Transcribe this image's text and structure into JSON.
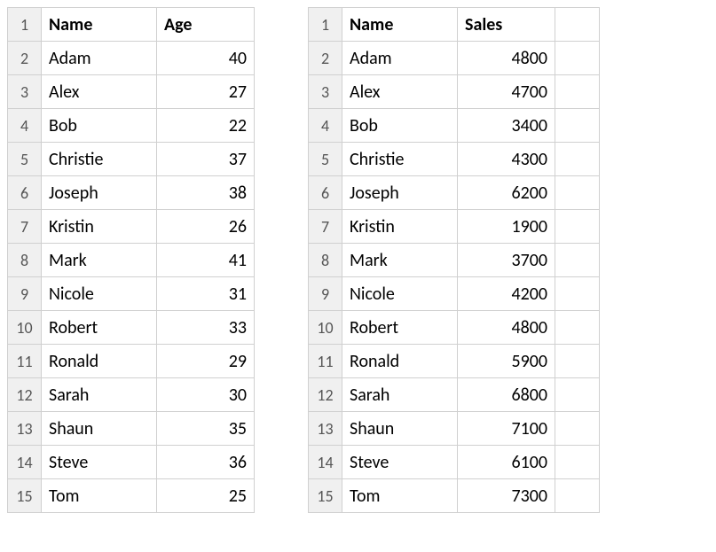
{
  "tables": [
    {
      "headers": {
        "col1": "Name",
        "col2": "Age"
      },
      "rows": [
        {
          "n": "1"
        },
        {
          "n": "2",
          "name": "Adam",
          "val": "40"
        },
        {
          "n": "3",
          "name": "Alex",
          "val": "27"
        },
        {
          "n": "4",
          "name": "Bob",
          "val": "22"
        },
        {
          "n": "5",
          "name": "Christie",
          "val": "37"
        },
        {
          "n": "6",
          "name": "Joseph",
          "val": "38"
        },
        {
          "n": "7",
          "name": "Kristin",
          "val": "26"
        },
        {
          "n": "8",
          "name": "Mark",
          "val": "41"
        },
        {
          "n": "9",
          "name": "Nicole",
          "val": "31"
        },
        {
          "n": "10",
          "name": "Robert",
          "val": "33"
        },
        {
          "n": "11",
          "name": "Ronald",
          "val": "29"
        },
        {
          "n": "12",
          "name": "Sarah",
          "val": "30"
        },
        {
          "n": "13",
          "name": "Shaun",
          "val": "35"
        },
        {
          "n": "14",
          "name": "Steve",
          "val": "36"
        },
        {
          "n": "15",
          "name": "Tom",
          "val": "25"
        }
      ]
    },
    {
      "headers": {
        "col1": "Name",
        "col2": "Sales"
      },
      "rows": [
        {
          "n": "1"
        },
        {
          "n": "2",
          "name": "Adam",
          "val": "4800"
        },
        {
          "n": "3",
          "name": "Alex",
          "val": "4700"
        },
        {
          "n": "4",
          "name": "Bob",
          "val": "3400"
        },
        {
          "n": "5",
          "name": "Christie",
          "val": "4300"
        },
        {
          "n": "6",
          "name": "Joseph",
          "val": "6200"
        },
        {
          "n": "7",
          "name": "Kristin",
          "val": "1900"
        },
        {
          "n": "8",
          "name": "Mark",
          "val": "3700"
        },
        {
          "n": "9",
          "name": "Nicole",
          "val": "4200"
        },
        {
          "n": "10",
          "name": "Robert",
          "val": "4800"
        },
        {
          "n": "11",
          "name": "Ronald",
          "val": "5900"
        },
        {
          "n": "12",
          "name": "Sarah",
          "val": "6800"
        },
        {
          "n": "13",
          "name": "Shaun",
          "val": "7100"
        },
        {
          "n": "14",
          "name": "Steve",
          "val": "6100"
        },
        {
          "n": "15",
          "name": "Tom",
          "val": "7300"
        }
      ]
    }
  ]
}
